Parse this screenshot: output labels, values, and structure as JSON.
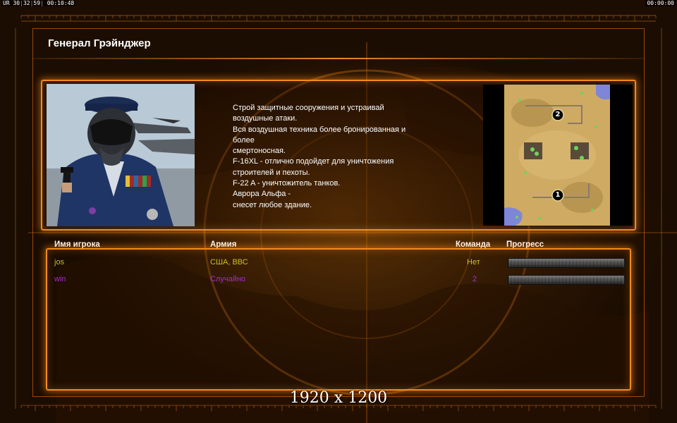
{
  "hud": {
    "left_prefix": "UR",
    "left_stat_a": "30",
    "left_stat_b": "32",
    "left_stat_c": "59",
    "left_time": "00:10:48",
    "right_time": "00:00:00"
  },
  "general": {
    "title": "Генерал Грэйнджер",
    "briefing": "Строй защитные сооружения и устраивай\n воздушные атаки.\nВся воздушная техника более бронированная и\n более\nсмертоносная.\nF-16XL - отлично подойдет для уничтожения\n строителей и пехоты.\nF-22 A - уничтожитель танков.\nАврора Альфа -\nснесет любое здание."
  },
  "map": {
    "start_positions": [
      "2",
      "1"
    ]
  },
  "players_table": {
    "headers": {
      "name": "Имя игрока",
      "army": "Армия",
      "team": "Команда",
      "progress": "Прогресс"
    },
    "rows": [
      {
        "name": "jos",
        "army": "США, ВВС",
        "team": "Нет",
        "color": "#c8c01e",
        "progress": 0
      },
      {
        "name": "win",
        "army": "Случайно",
        "team": "2",
        "color": "#a52bd4",
        "progress": 0
      }
    ]
  },
  "overlay": {
    "resolution": "1920 x 1200"
  },
  "colors": {
    "accent": "#f18a1e",
    "player1": "#c8c01e",
    "player2": "#a52bd4"
  }
}
